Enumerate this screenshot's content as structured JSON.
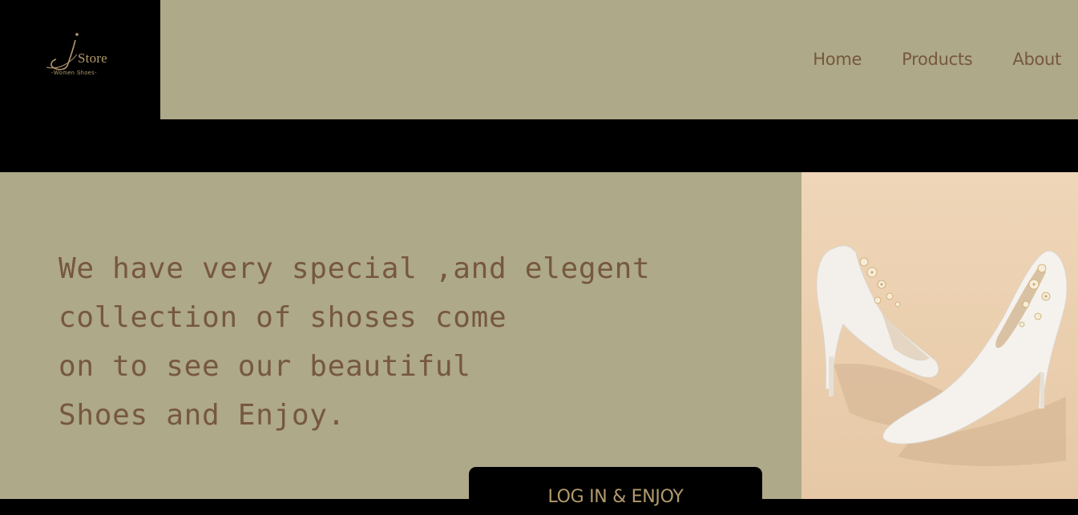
{
  "brand": {
    "name": "Store",
    "tagline": "-Women Shoes-",
    "accent": "#b39a6e"
  },
  "nav": {
    "items": [
      {
        "label": "Home"
      },
      {
        "label": "Products"
      },
      {
        "label": "About"
      }
    ]
  },
  "hero": {
    "lines": [
      "We have very special ,and elegent",
      "collection of shoses come",
      "on to see our beautiful",
      "Shoes and Enjoy."
    ],
    "cta_label": "LOG IN & ENJOY",
    "image_icon": "white-high-heel-shoes-photo"
  },
  "colors": {
    "background": "#aea988",
    "text": "#76583f",
    "dark": "#000000",
    "photo_bg": "#ebd3b5"
  }
}
